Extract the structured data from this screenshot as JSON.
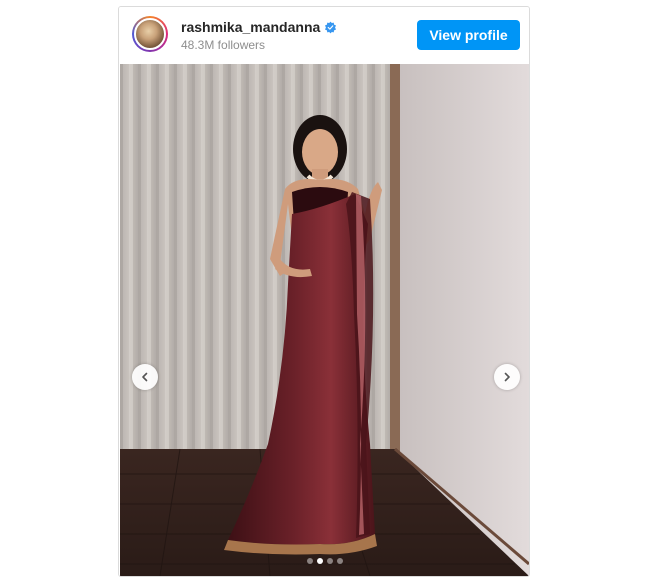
{
  "post": {
    "username": "rashmika_mandanna",
    "followers": "48.3M followers",
    "view_profile_label": "View profile",
    "verified": true
  },
  "carousel": {
    "slide_count": 4,
    "active_index": 1
  },
  "colors": {
    "accent": "#0095f6",
    "verified_badge": "#3897f0",
    "saree": "#5a1a22"
  },
  "icons": [
    "verified-badge-icon",
    "chevron-left-icon",
    "chevron-right-icon"
  ]
}
